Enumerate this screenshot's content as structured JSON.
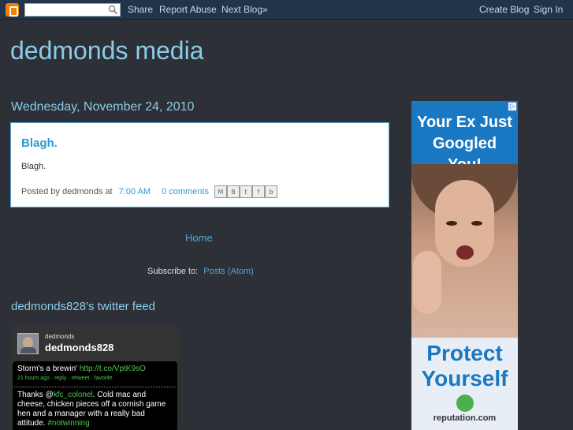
{
  "navbar": {
    "share": "Share",
    "report_abuse": "Report Abuse",
    "next_blog": "Next Blog»",
    "create_blog": "Create Blog",
    "sign_in": "Sign In",
    "search_value": ""
  },
  "blog": {
    "title": "dedmonds media"
  },
  "post": {
    "date": "Wednesday, November 24, 2010",
    "title": "Blagh.",
    "body": "Blagh.",
    "posted_by": "Posted by dedmonds at",
    "time": "7:00 AM",
    "comments": "0 comments",
    "share_icons": [
      "email-icon",
      "blogthis-icon",
      "twitter-icon",
      "facebook-icon",
      "buzz-icon"
    ]
  },
  "footer": {
    "home": "Home",
    "subscribe_label": "Subscribe to:",
    "subscribe_link": "Posts (Atom)"
  },
  "twitter": {
    "widget_title": "dedmonds828's twitter feed",
    "user_small": "dedmonds",
    "user_big": "dedmonds828",
    "tweets": [
      {
        "text": "Storm's a brewin'",
        "link": "http://t.co/VptK9sO",
        "meta": "21 hours ago · reply · retweet · favorite"
      },
      {
        "prefix": "Thanks @",
        "mention": "kfc_colonel",
        "text": ". Cold mac and cheese, chicken pieces off a cornish game hen and a manager with a really bad attitude. ",
        "hashtag": "#notwinning"
      }
    ]
  },
  "ad": {
    "headline": "Your Ex Just Googled You!",
    "protect": "Protect Yourself",
    "brand": "reputation.com",
    "choices_icon": "adchoices-icon",
    "accent": "#1a78c2"
  }
}
